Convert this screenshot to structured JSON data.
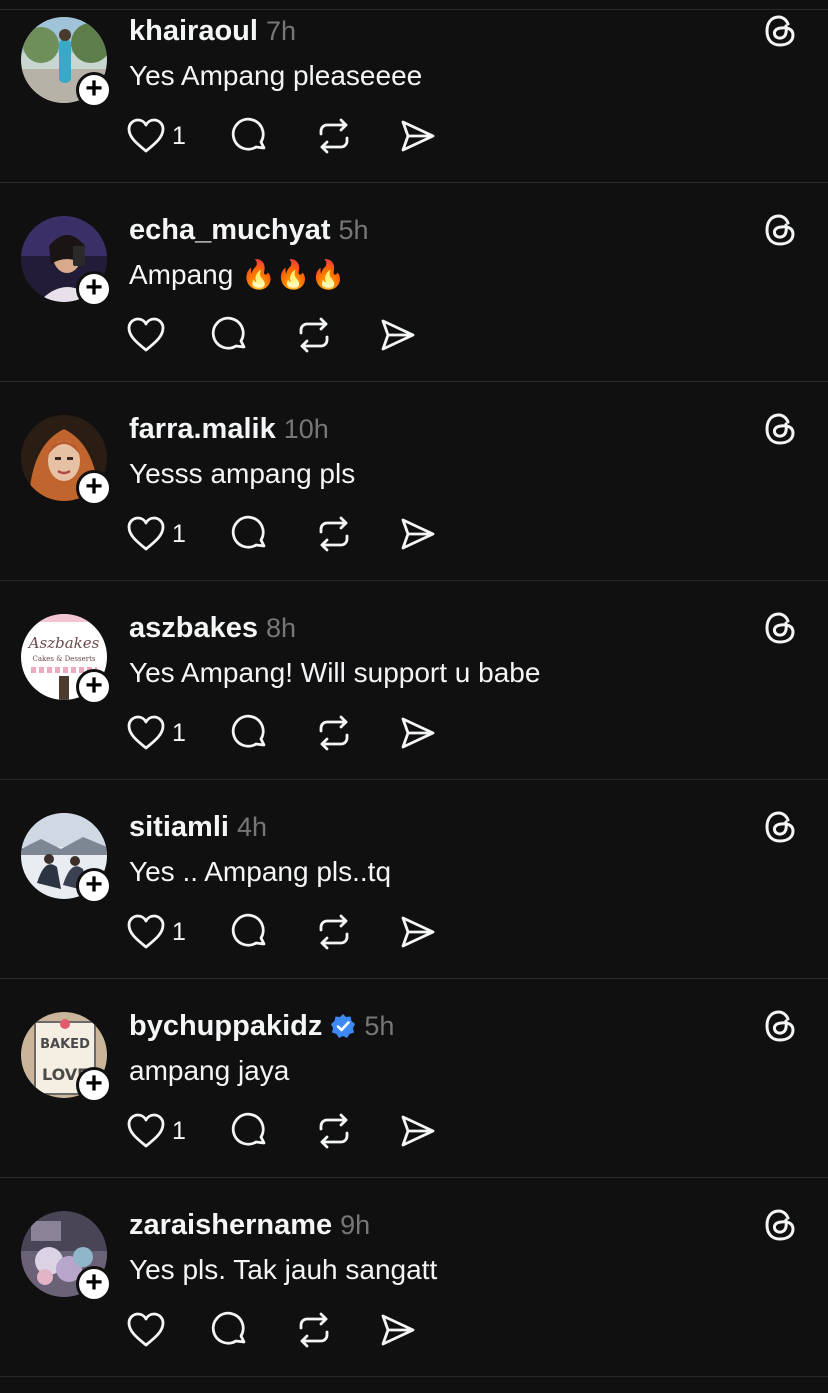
{
  "colors": {
    "background": "#101010",
    "divider": "#2a2a2a",
    "text_primary": "#f3f5f7",
    "text_secondary": "#777777",
    "verified": "#3d8af7"
  },
  "icons": {
    "like": "heart-icon",
    "reply": "speech-bubble-icon",
    "repost": "repost-arrows-icon",
    "share": "paper-plane-icon",
    "threads": "threads-logo-icon",
    "follow": "plus-icon",
    "verified": "verified-badge-icon"
  },
  "follow_symbol": "+",
  "posts": [
    {
      "username": "khairaoul",
      "time": "7h",
      "text": "Yes Ampang pleaseeee",
      "likes": "1",
      "verified": false,
      "avatar": "outdoor-photo"
    },
    {
      "username": "echa_muchyat",
      "time": "5h",
      "text": "Ampang 🔥🔥🔥",
      "likes": "",
      "verified": false,
      "avatar": "selfie-photo"
    },
    {
      "username": "farra.malik",
      "time": "10h",
      "text": "Yesss ampang pls",
      "likes": "1",
      "verified": false,
      "avatar": "portrait-photo"
    },
    {
      "username": "aszbakes",
      "time": "8h",
      "text": "Yes Ampang! Will support u babe",
      "likes": "1",
      "verified": false,
      "avatar": "aszbakes-logo",
      "avatar_text": "Aszbakes",
      "avatar_subtext": "Cakes & Desserts"
    },
    {
      "username": "sitiamli",
      "time": "4h",
      "text": "Yes .. Ampang pls..tq",
      "likes": "1",
      "verified": false,
      "avatar": "snow-photo"
    },
    {
      "username": "bychuppakidz",
      "time": "5h",
      "text": "ampang jaya",
      "likes": "1",
      "verified": true,
      "avatar": "baked-with-love-sign",
      "avatar_text": "BAKED",
      "avatar_subtext": "LOVE"
    },
    {
      "username": "zaraishername",
      "time": "9h",
      "text": "Yes pls. Tak jauh sangatt",
      "likes": "",
      "verified": false,
      "avatar": "flowers-photo"
    }
  ]
}
